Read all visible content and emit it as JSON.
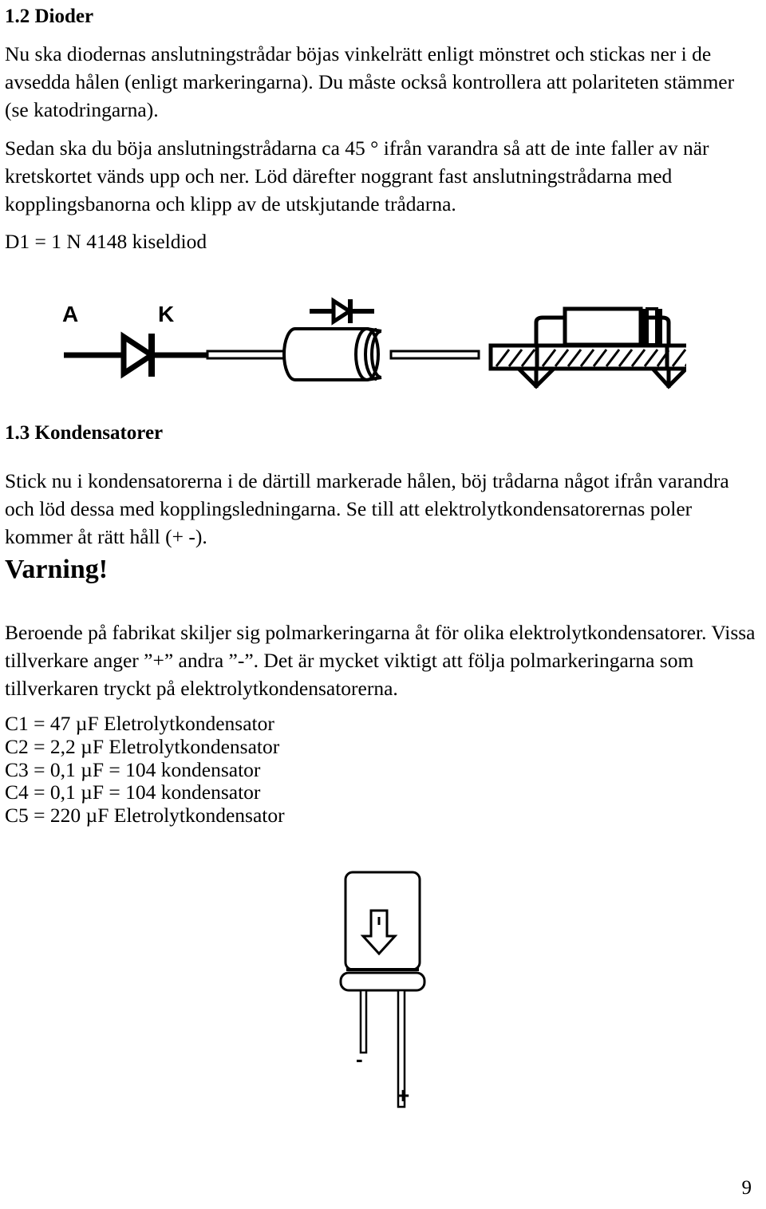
{
  "document": {
    "page_number": "9",
    "sections": [
      {
        "id": "dioder",
        "heading": "1.2 Dioder",
        "paragraphs": [
          "Nu ska diodernas anslutningstrådar böjas vinkelrätt enligt mönstret och stickas ner i de avsedda hålen (enligt markeringarna). Du måste också kontrollera att polariteten stämmer (se katodringarna).",
          "Sedan ska du böja anslutningstrådarna ca 45 ° ifrån varandra så att de inte faller av när kretskortet vänds upp och ner. Löd därefter noggrant fast anslutningstrådarna med kopplingsbanorna och klipp av de utskjutande trådarna."
        ],
        "component_line": "D1 = 1 N 4148    kiseldiod"
      },
      {
        "id": "kondensatorer",
        "heading": "1.3 Kondensatorer",
        "paragraphs": [
          "Stick nu i kondensatorerna i de därtill markerade hålen, böj trådarna något ifrån varandra och löd dessa med kopplingsledningarna. Se till att elektrolytkondensatorernas poler kommer åt rätt håll (+ -)."
        ],
        "warning_heading": "Varning!",
        "warning_paragraph": "Beroende på fabrikat skiljer sig polmarkeringarna åt för olika elektrolytkondensatorer. Vissa tillverkare anger ”+” andra ”-”.  Det är mycket viktigt att följa polmarkeringarna som tillverkaren tryckt på elektrolytkondensatorerna.",
        "component_lines": [
          "C1 =  47 µF Eletrolytkondensator",
          "C2 = 2,2 µF Eletrolytkondensator",
          "C3 = 0,1 µF = 104 kondensator",
          "C4 = 0,1 µF = 104 kondensator",
          "C5 = 220 µF Eletrolytkondensator"
        ]
      }
    ]
  },
  "diode_figure": {
    "anode_label": "A",
    "cathode_label": "K"
  },
  "capacitor_figure": {
    "negative_label": "-",
    "positive_label": "+"
  },
  "colors": {
    "ink": "#000000",
    "paper": "#ffffff"
  }
}
